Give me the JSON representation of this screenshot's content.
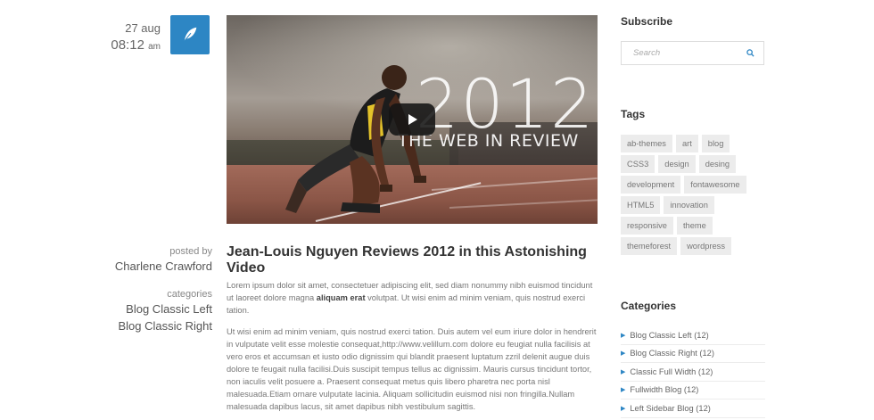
{
  "post": {
    "day": "27 aug",
    "time": "08:12",
    "ampm": "am",
    "format_icon": "quill-pen-icon",
    "accent_color": "#2d86c4",
    "video": {
      "overlay_year": "2012",
      "overlay_subtitle": "THE WEB IN REVIEW",
      "play_icon": "play-icon"
    },
    "posted_by_label": "posted by",
    "author": "Charlene Crawford",
    "categories_label": "categories",
    "categories": [
      "Blog Classic Left",
      "Blog Classic Right"
    ],
    "title": "Jean-Louis Nguyen Reviews 2012 in this Astonishing Video",
    "p1_start": "Lorem ipsum dolor sit amet, consectetuer adipiscing elit, sed diam nonummy nibh euismod tincidunt ut laoreet dolore magna ",
    "p1_bold": "aliquam erat",
    "p1_end": " volutpat. Ut wisi enim ad minim veniam, quis nostrud exerci tation.",
    "p2": "Ut wisi enim ad minim veniam, quis nostrud exerci tation. Duis autem vel eum iriure dolor in hendrerit in vulputate velit esse molestie consequat,http://www.velillum.com dolore eu feugiat nulla facilisis at vero eros et accumsan et iusto odio dignissim qui blandit praesent luptatum zzril delenit augue duis dolore te feugait nulla facilisi.Duis suscipit tempus tellus ac dignissim. Mauris cursus tincidunt tortor, non iaculis velit posuere a. Praesent consequat metus quis libero pharetra nec porta nisl malesuada.Etiam ornare vulputate lacinia. Aliquam sollicitudin euismod nisi non fringilla.Nullam malesuada dapibus lacus, sit amet dapibus nibh vestibulum sagittis."
  },
  "sidebar": {
    "subscribe_heading": "Subscribe",
    "search_placeholder": "Search",
    "search_icon": "search-icon",
    "tags_heading": "Tags",
    "tags": [
      "ab-themes",
      "art",
      "blog",
      "CSS3",
      "design",
      "desing",
      "development",
      "fontawesome",
      "HTML5",
      "innovation",
      "responsive",
      "theme",
      "themeforest",
      "wordpress"
    ],
    "categories_heading": "Categories",
    "categories": [
      {
        "label": "Blog Classic Left (12)"
      },
      {
        "label": "Blog Classic Right (12)"
      },
      {
        "label": "Classic Full Width (12)"
      },
      {
        "label": "Fullwidth Blog (12)"
      },
      {
        "label": "Left Sidebar Blog (12)"
      }
    ],
    "bullet_icon": "triangle-right-icon"
  }
}
